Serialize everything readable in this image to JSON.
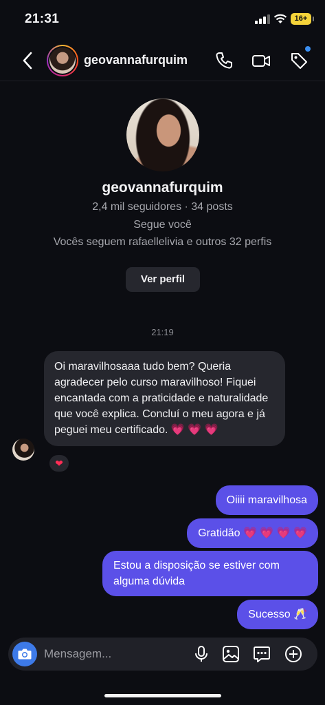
{
  "status": {
    "time": "21:31",
    "battery": "16+"
  },
  "header": {
    "username": "geovannafurquim"
  },
  "profile": {
    "name": "geovannafurquim",
    "stats": "2,4 mil seguidores · 34 posts",
    "follows_you": "Segue você",
    "mutuals": "Vocês seguem rafaellelivia e outros 32 perfis",
    "view_button": "Ver perfil"
  },
  "thread": {
    "timestamp": "21:19",
    "incoming": {
      "text": "Oi maravilhosaaa tudo bem? Queria agradecer pelo curso maravilhoso! Fiquei encantada com a praticidade e naturalidade que você explica. Concluí o meu agora e já peguei meu certificado. 💗 💗 💗",
      "reaction": "❤"
    },
    "outgoing": [
      "Oiiii maravilhosa",
      "Gratidão 💗 💗 💗 💗",
      "Estou a disposição se estiver com alguma dúvida",
      "Sucesso 🥂"
    ]
  },
  "composer": {
    "placeholder": "Mensagem..."
  },
  "colors": {
    "outgoing_bubble": "#5b50e8",
    "incoming_bubble": "#26272e",
    "camera_button": "#3d7ae8",
    "background": "#0c0d12"
  }
}
